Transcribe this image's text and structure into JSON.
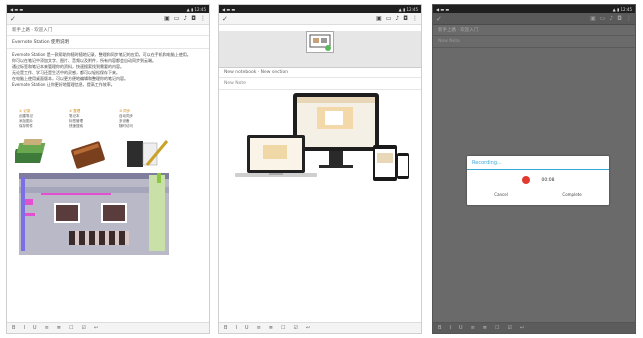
{
  "status": {
    "time": "12:45",
    "right": "▲ ▮ 12:45"
  },
  "toolbar_icons": [
    "camera-icon",
    "attach-icon",
    "mic-icon",
    "image-icon",
    "more-icon"
  ],
  "bottom_icons": [
    "B",
    "I",
    "U",
    "≡",
    "≣",
    "☐",
    "☑",
    "↩"
  ],
  "phone1": {
    "meta": "新手上路 · 欢迎入门",
    "title": "Evernote Station 使用说明",
    "paragraph": [
      "Evernote Station 是一款帮助你随时随地记录、整理和同步笔记的应用，可以在手机和电脑上使用。",
      "你可以在笔记中添加文字、图片、音频以及附件，所有内容都会自动同步到云端。",
      "通过标签和笔记本来管理你的资料，快速搜索找到需要的内容。",
      "无论是工作、学习还是生活中的灵感，都可以轻松保存下来。",
      "在电脑上使用桌面版本，可以更方便地编辑和整理你的笔记内容。",
      "Evernote Station 让你更好地管理信息，提高工作效率。"
    ],
    "columns": [
      {
        "head": "① 记录",
        "lines": [
          "创建笔记",
          "添加图片",
          "保存附件"
        ]
      },
      {
        "head": "② 整理",
        "lines": [
          "笔记本",
          "标签管理",
          "快速搜索"
        ]
      },
      {
        "head": "③ 同步",
        "lines": [
          "自动同步",
          "多设备",
          "随时访问"
        ]
      }
    ]
  },
  "phone2": {
    "meta": "New notebook · New section",
    "title": "New Note"
  },
  "phone3": {
    "meta": "新手上路 · 欢迎入门",
    "title": "New Note",
    "dialog": {
      "title": "Recording...",
      "time": "00:08",
      "cancel": "Cancel",
      "complete": "Complete"
    }
  },
  "colors": {
    "accent": "#3aa6d8",
    "record": "#e23b2e"
  }
}
